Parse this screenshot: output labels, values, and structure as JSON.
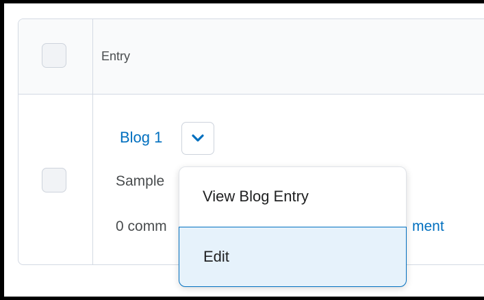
{
  "table": {
    "header": {
      "entry_label": "Entry"
    },
    "row": {
      "title": "Blog 1",
      "description_partial": "Sample",
      "comments_partial": "0 comm",
      "comment_link_partial": "ment"
    }
  },
  "dropdown": {
    "items": [
      {
        "label": "View Blog Entry",
        "state": "default"
      },
      {
        "label": "Edit",
        "state": "focused"
      }
    ]
  },
  "colors": {
    "link": "#006fbf",
    "focus_border": "#006fbf",
    "focus_background": "#e6f2fb",
    "border": "#d3d9e3",
    "text": "#494c4e"
  },
  "icons": {
    "dropdown_toggle": "chevron-down-icon"
  }
}
